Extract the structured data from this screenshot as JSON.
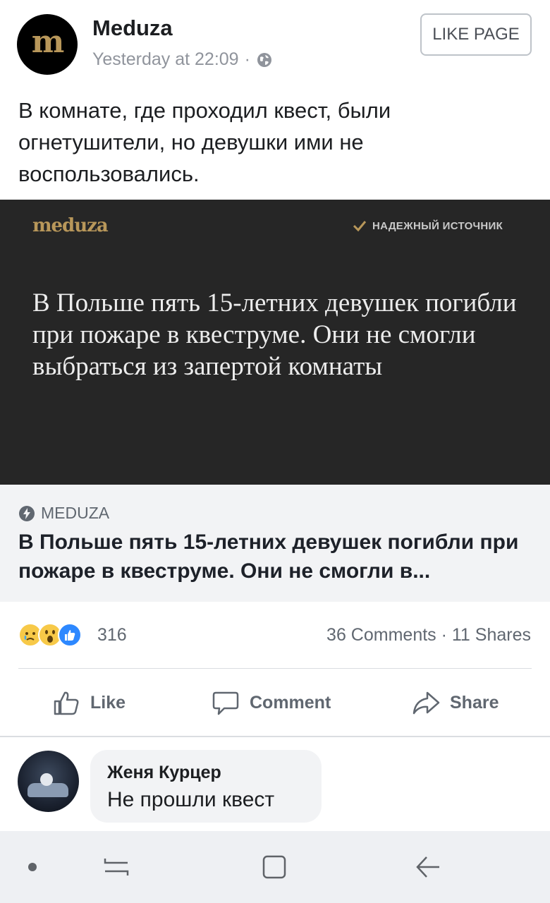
{
  "post": {
    "page_name": "Meduza",
    "page_avatar_letter": "m",
    "timestamp": "Yesterday at 22:09",
    "separator": "·",
    "privacy_icon": "globe-icon",
    "like_page_label": "LIKE PAGE",
    "text": "В комнате, где проходил квест, были огнетушители, но девушки ими не воспользовались."
  },
  "link_preview": {
    "image": {
      "logo": "meduza",
      "badge": "НАДЕЖНЫЙ ИСТОЧНИК",
      "headline": "В Польше пять 15-летних девушек погибли при пожаре в квеструме. Они не смогли выбраться из запертой комнаты",
      "background": "#262626",
      "accent": "#b8975a"
    },
    "source": "MEDUZA",
    "title": "В Польше пять 15-летних девушек погибли при пожаре в квеструме. Они не смогли в..."
  },
  "stats": {
    "reactions": [
      "sad-reaction-icon",
      "wow-reaction-icon",
      "like-reaction-icon"
    ],
    "reaction_count": "316",
    "comments_shares": "36 Comments · 11 Shares"
  },
  "actions": {
    "like": "Like",
    "comment": "Comment",
    "share": "Share"
  },
  "comment": {
    "author": "Женя Курцер",
    "text": "Не прошли квест"
  },
  "navbar": {
    "items": [
      "dot-icon",
      "recent-apps-icon",
      "home-icon",
      "back-icon"
    ]
  },
  "colors": {
    "facebook_blue": "#2d88ff",
    "secondary_text": "#606770",
    "meduza_gold": "#b8975a"
  }
}
